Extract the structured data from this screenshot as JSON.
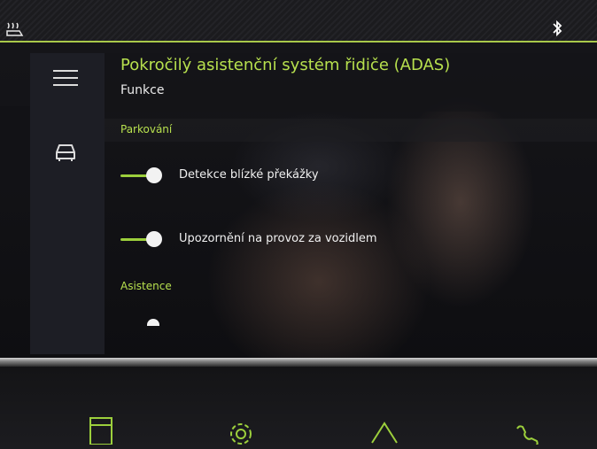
{
  "status_bar": {
    "left_icon": "seat-heat-icon",
    "right_icon": "bluetooth-icon"
  },
  "nav": {
    "items": [
      {
        "icon": "menu-icon"
      },
      {
        "icon": "car-icon"
      }
    ]
  },
  "header": {
    "title": "Pokročilý asistenční systém řidiče (ADAS)",
    "subtitle": "Funkce"
  },
  "sections": [
    {
      "label": "Parkování",
      "items": [
        {
          "label": "Detekce blízké překážky",
          "enabled": true
        },
        {
          "label": "Upozornění na provoz za vozidlem",
          "enabled": true
        }
      ]
    },
    {
      "label": "Asistence",
      "items": []
    }
  ],
  "dock": {
    "items": [
      {
        "icon": "media-icon"
      },
      {
        "icon": "settings-gear-icon"
      },
      {
        "icon": "navigation-icon"
      },
      {
        "icon": "phone-icon"
      }
    ]
  },
  "colors": {
    "accent": "#b7e04e",
    "toggle_on": "#9ccf3c",
    "text": "#f0f0f0"
  }
}
